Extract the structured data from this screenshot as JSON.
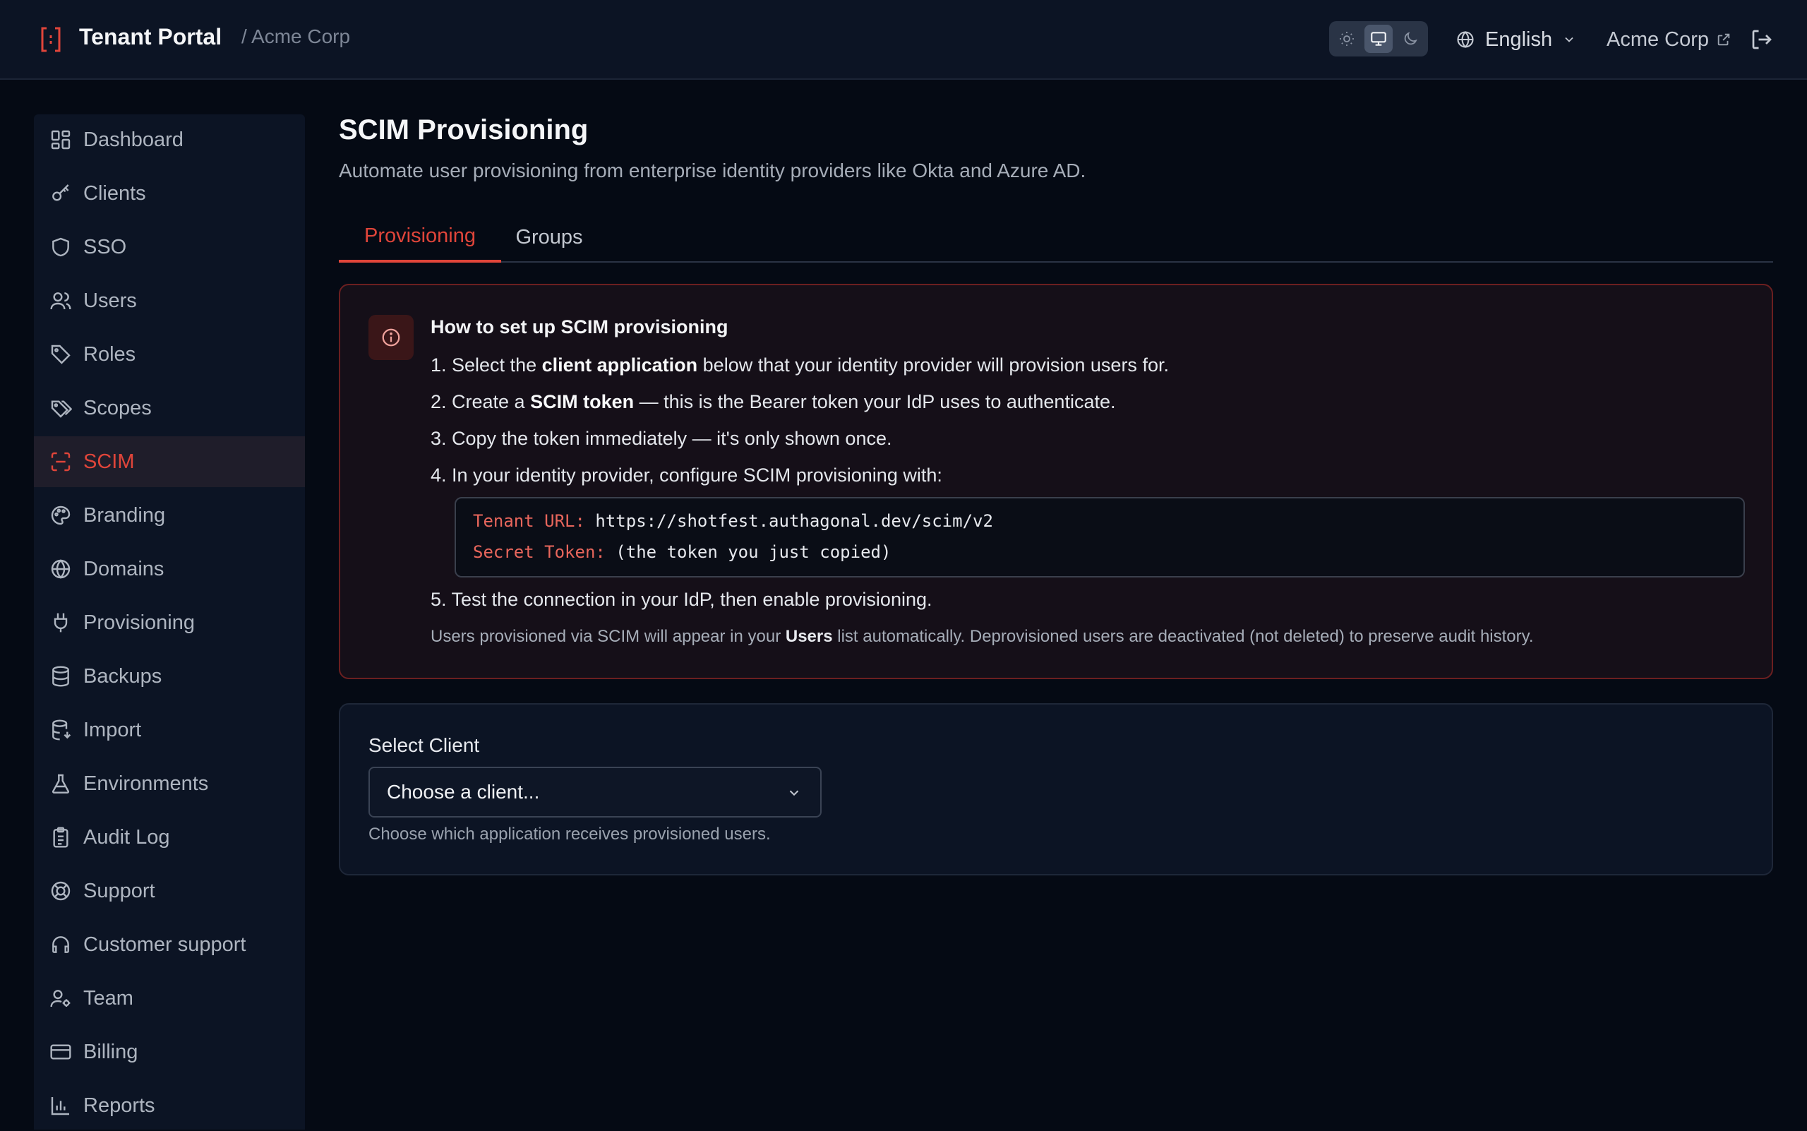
{
  "header": {
    "title": "Tenant Portal",
    "breadcrumb": "/ Acme Corp",
    "language": "English",
    "org_link": "Acme Corp",
    "theme_options": [
      "light",
      "system",
      "dark"
    ],
    "theme_selected": "system",
    "accent": "#e0453a"
  },
  "sidebar": {
    "items": [
      {
        "label": "Dashboard",
        "icon": "dashboard-icon"
      },
      {
        "label": "Clients",
        "icon": "key-icon"
      },
      {
        "label": "SSO",
        "icon": "shield-icon"
      },
      {
        "label": "Users",
        "icon": "users-icon"
      },
      {
        "label": "Roles",
        "icon": "tag-icon"
      },
      {
        "label": "Scopes",
        "icon": "tags-icon"
      },
      {
        "label": "SCIM",
        "icon": "scan-icon",
        "active": true
      },
      {
        "label": "Branding",
        "icon": "palette-icon"
      },
      {
        "label": "Domains",
        "icon": "globe-icon"
      },
      {
        "label": "Provisioning",
        "icon": "plug-icon"
      },
      {
        "label": "Backups",
        "icon": "database-icon"
      },
      {
        "label": "Import",
        "icon": "database-import-icon"
      },
      {
        "label": "Environments",
        "icon": "flask-icon"
      },
      {
        "label": "Audit Log",
        "icon": "clipboard-icon"
      },
      {
        "label": "Support",
        "icon": "lifebuoy-icon"
      },
      {
        "label": "Customer support",
        "icon": "headset-icon"
      },
      {
        "label": "Team",
        "icon": "user-cog-icon"
      },
      {
        "label": "Billing",
        "icon": "credit-card-icon"
      },
      {
        "label": "Reports",
        "icon": "bar-chart-icon"
      }
    ]
  },
  "main": {
    "title": "SCIM Provisioning",
    "subtitle": "Automate user provisioning from enterprise identity providers like Okta and Azure AD.",
    "tabs": [
      {
        "label": "Provisioning",
        "active": true
      },
      {
        "label": "Groups",
        "active": false
      }
    ],
    "info": {
      "title": "How to set up SCIM provisioning",
      "step1": {
        "pre": "1. Select the ",
        "bold": "client application",
        "post": " below that your identity provider will provision users for."
      },
      "step2": {
        "pre": "2. Create a ",
        "bold": "SCIM token",
        "post": " — this is the Bearer token your IdP uses to authenticate."
      },
      "step3": "3. Copy the token immediately — it's only shown once.",
      "step4": "4. In your identity provider, configure SCIM provisioning with:",
      "code": {
        "url_key": "Tenant URL:",
        "url_value": " https://shotfest.authagonal.dev/scim/v2",
        "token_key": "Secret Token:",
        "token_value": " (the token you just copied)"
      },
      "step5": "5. Test the connection in your IdP, then enable provisioning.",
      "note": {
        "pre": "Users provisioned via SCIM will appear in your ",
        "bold": "Users",
        "post": " list automatically. Deprovisioned users are deactivated (not deleted) to preserve audit history."
      }
    },
    "client_card": {
      "label": "Select Client",
      "select_value": "Choose a client...",
      "help": "Choose which application receives provisioned users."
    }
  }
}
